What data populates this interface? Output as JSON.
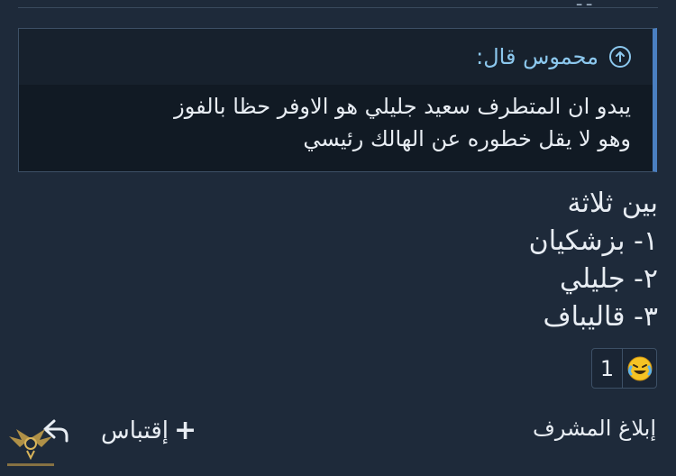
{
  "top": {
    "fragment": "ـ ـ"
  },
  "quote": {
    "author_label": "محموس قال:",
    "lines": [
      "يبدو ان المتطرف سعيد جليلي هو الاوفر حظا بالفوز",
      "وهو لا يقل خطوره عن الهالك رئيسي"
    ]
  },
  "post": {
    "lines": [
      "بين ثلاثة",
      "١- بزشكيان",
      "٢- جليلي",
      "٣- قاليباف"
    ]
  },
  "reaction": {
    "icon": "laughing-tears-emoji-icon",
    "count": "1"
  },
  "actions": {
    "report_label": "إبلاغ المشرف",
    "quote_label": "إقتباس",
    "quote_icon": "plus-icon",
    "reply_icon": "reply-arrow-icon"
  },
  "colors": {
    "background": "#1e2a3a",
    "quote_background": "#111a24",
    "quote_accent": "#4a7fc1",
    "author_color": "#8cc8ee"
  }
}
